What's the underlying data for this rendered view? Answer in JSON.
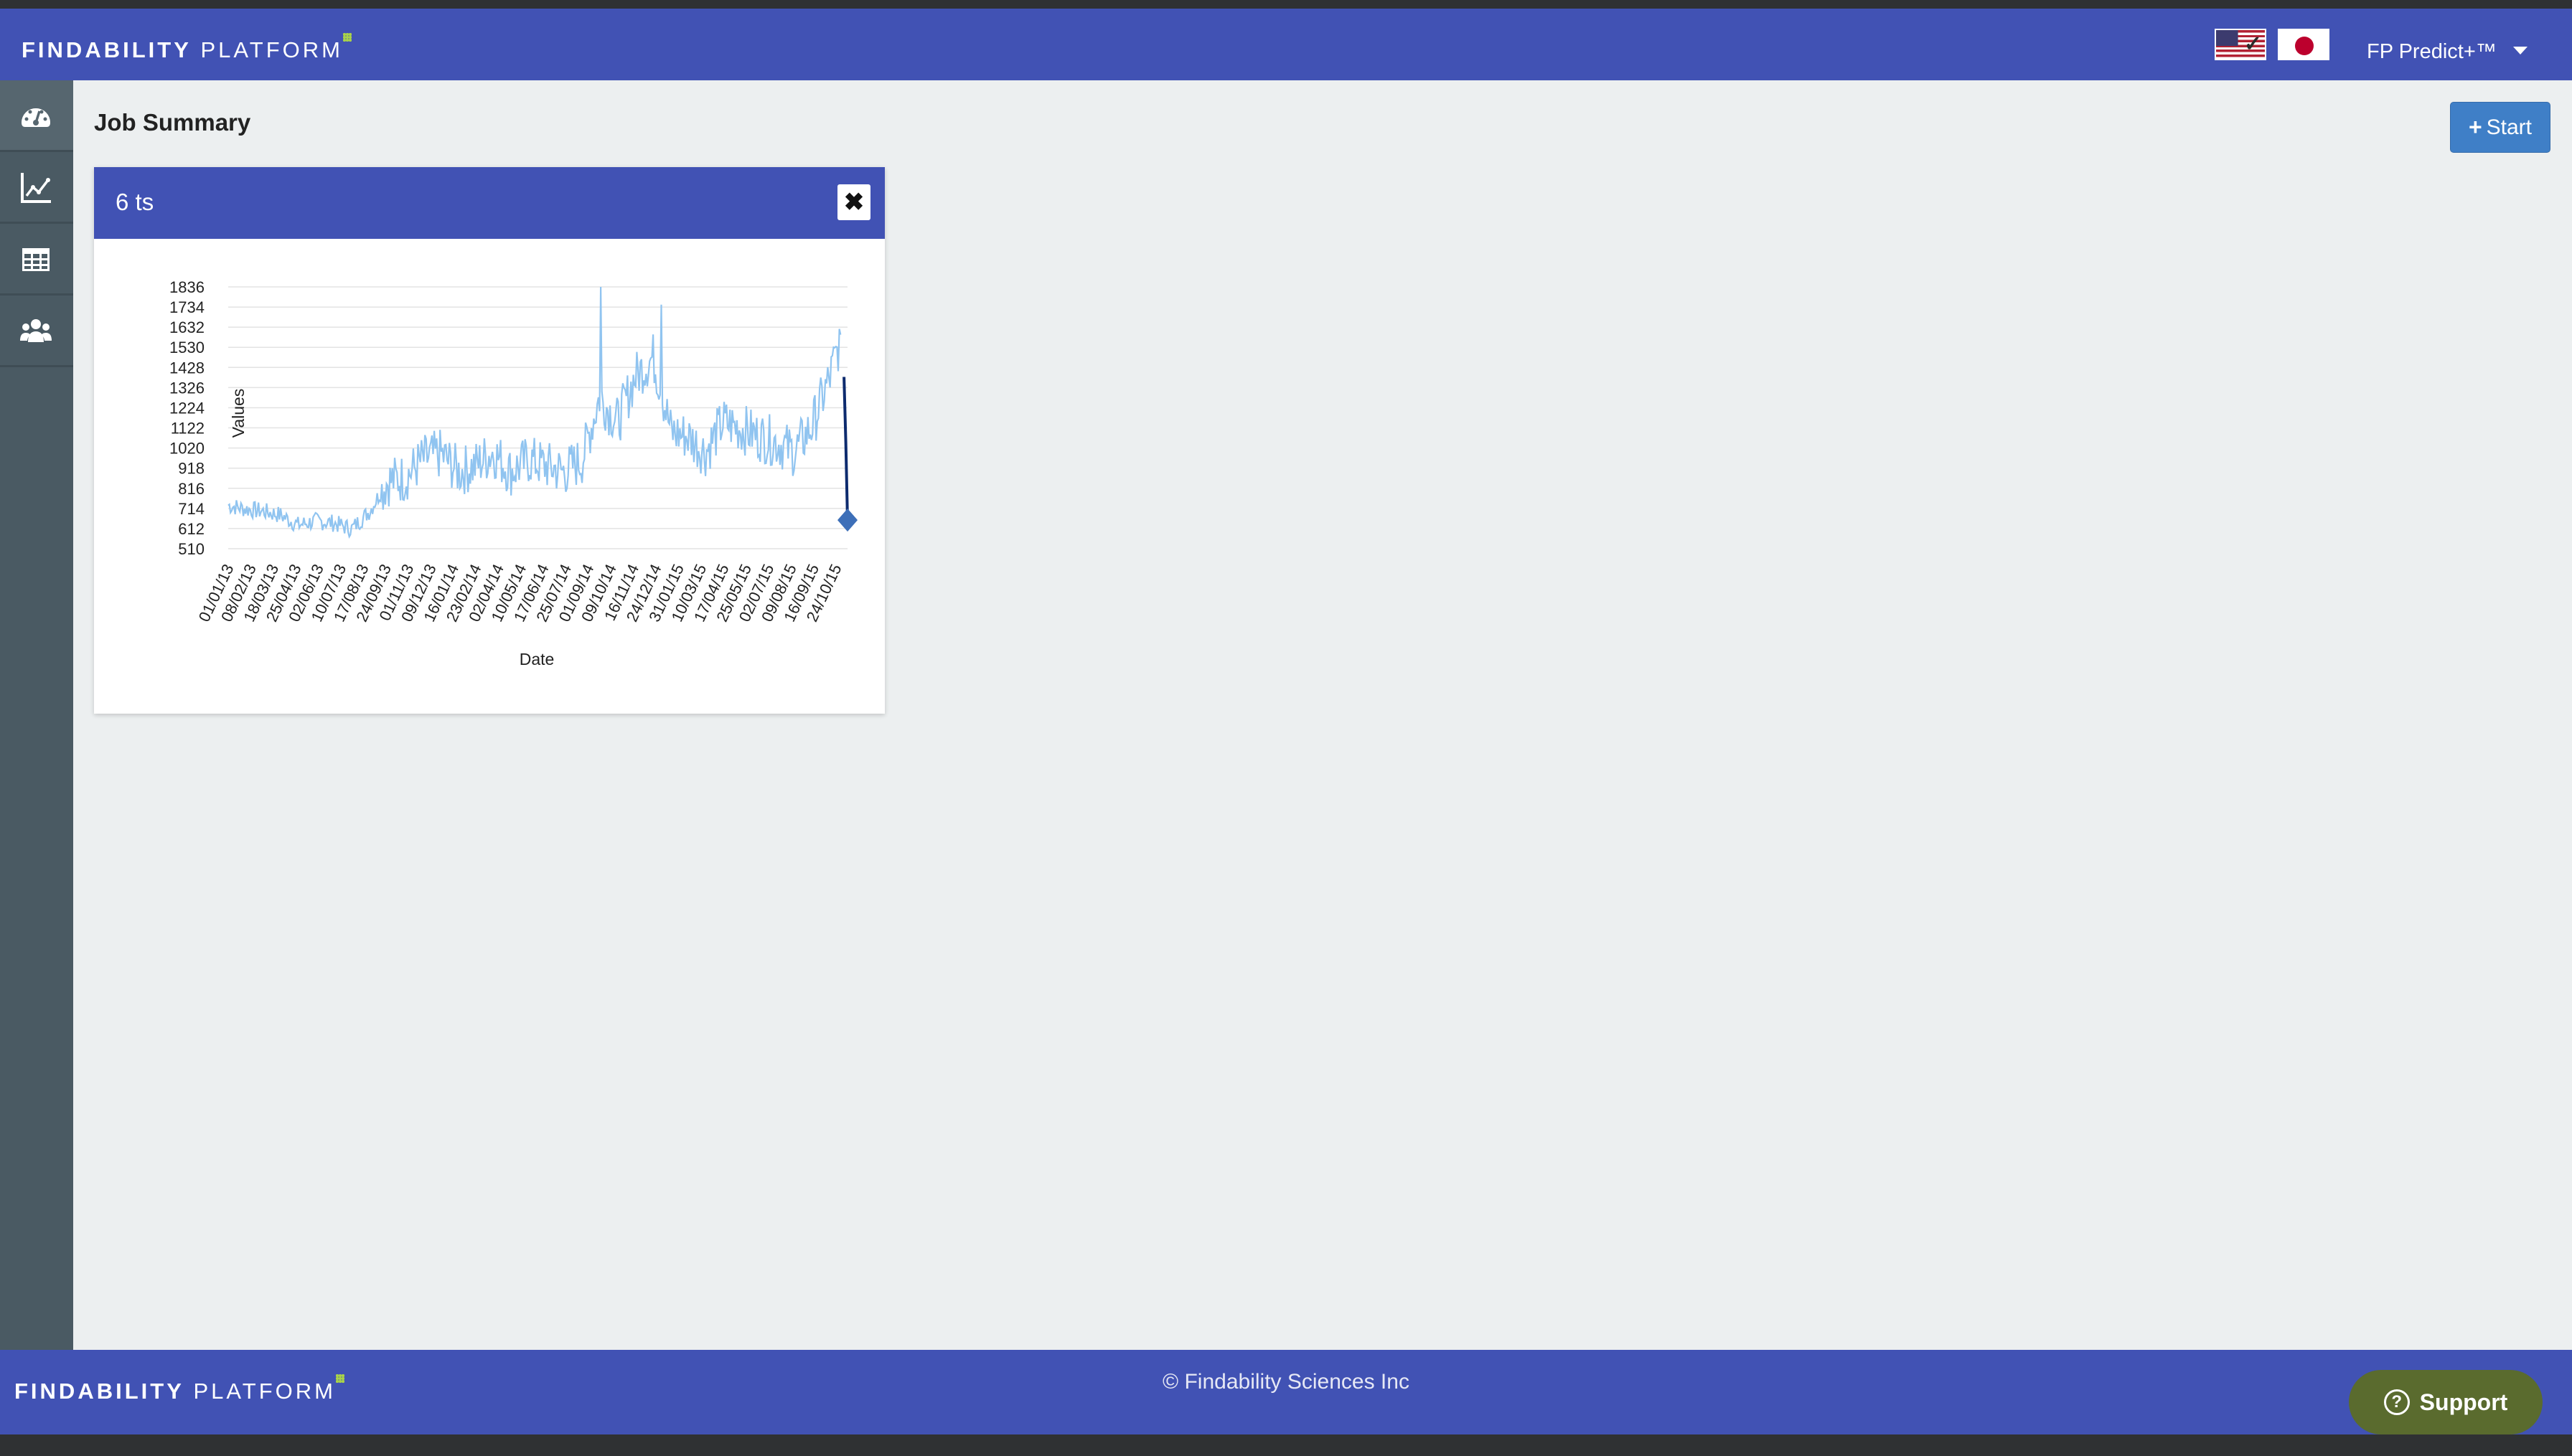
{
  "brand": {
    "logo_bold": "FINDABILITY",
    "logo_light": "PLATFORM"
  },
  "header": {
    "flags": [
      "us-flag-icon",
      "japan-flag-icon"
    ],
    "product_name": "FP Predict+™"
  },
  "sidebar": {
    "items": [
      "dashboard-icon",
      "line-chart-icon",
      "table-icon",
      "users-icon"
    ],
    "active_index": 0
  },
  "page": {
    "title": "Job Summary",
    "start_button": "Start"
  },
  "panel": {
    "title": "6 ts",
    "close_label": "✖"
  },
  "footer": {
    "copyright": "© Findability Sciences Inc",
    "support_label": "Support"
  },
  "colors": {
    "header": "#4152b4",
    "sidebar": "#4a5a63",
    "series": "#90c4f0",
    "forecast": "#0d2b6e",
    "start_button": "#3f7fc7",
    "support_button": "#5a6b2e"
  },
  "chart_data": {
    "type": "line",
    "xlabel": "Date",
    "ylabel": "Values",
    "ylim": [
      510,
      1836
    ],
    "y_ticks": [
      1836,
      1734,
      1632,
      1530,
      1428,
      1326,
      1224,
      1122,
      1020,
      918,
      816,
      714,
      612,
      510
    ],
    "x_ticks": [
      "01/01/13",
      "08/02/13",
      "18/03/13",
      "25/04/13",
      "02/06/13",
      "10/07/13",
      "17/08/13",
      "24/09/13",
      "01/11/13",
      "09/12/13",
      "16/01/14",
      "23/02/14",
      "02/04/14",
      "10/05/14",
      "17/06/14",
      "25/07/14",
      "01/09/14",
      "09/10/14",
      "16/11/14",
      "24/12/14",
      "31/01/15",
      "10/03/15",
      "17/04/15",
      "25/05/15",
      "02/07/15",
      "09/08/15",
      "16/09/15",
      "24/10/15"
    ],
    "x_range": [
      "2013-01-01",
      "2015-12-01"
    ],
    "grid": true,
    "legend": "none",
    "series": [
      {
        "role": "history",
        "points": [
          [
            "2013-01-01",
            730
          ],
          [
            "2013-02-01",
            710
          ],
          [
            "2013-03-01",
            700
          ],
          [
            "2013-04-01",
            680
          ],
          [
            "2013-05-01",
            630
          ],
          [
            "2013-06-01",
            650
          ],
          [
            "2013-07-01",
            640
          ],
          [
            "2013-08-01",
            610
          ],
          [
            "2013-09-01",
            700
          ],
          [
            "2013-10-01",
            850
          ],
          [
            "2013-11-01",
            870
          ],
          [
            "2013-12-01",
            960
          ],
          [
            "2014-01-01",
            990
          ],
          [
            "2014-02-01",
            900
          ],
          [
            "2014-03-01",
            930
          ],
          [
            "2014-04-01",
            1000
          ],
          [
            "2014-05-01",
            900
          ],
          [
            "2014-06-01",
            960
          ],
          [
            "2014-07-01",
            930
          ],
          [
            "2014-08-01",
            900
          ],
          [
            "2014-09-01",
            960
          ],
          [
            "2014-10-01",
            1280
          ],
          [
            "2014-11-01",
            1150
          ],
          [
            "2014-12-01",
            1380
          ],
          [
            "2015-01-01",
            1480
          ],
          [
            "2015-02-01",
            1100
          ],
          [
            "2015-03-01",
            1080
          ],
          [
            "2015-04-01",
            1000
          ],
          [
            "2015-05-01",
            1150
          ],
          [
            "2015-06-01",
            1120
          ],
          [
            "2015-07-01",
            1080
          ],
          [
            "2015-08-01",
            1050
          ],
          [
            "2015-09-01",
            1000
          ],
          [
            "2015-10-01",
            1130
          ],
          [
            "2015-11-01",
            1380
          ],
          [
            "2015-11-20",
            1580
          ]
        ],
        "peaks": [
          [
            "2014-10-03",
            1836
          ],
          [
            "2015-01-15",
            1746
          ],
          [
            "2015-11-20",
            1594
          ]
        ]
      },
      {
        "role": "forecast",
        "points": [
          [
            "2015-11-25",
            1380
          ],
          [
            "2015-11-28",
            1050
          ],
          [
            "2015-12-01",
            655
          ]
        ],
        "end_marker": "diamond"
      }
    ]
  }
}
